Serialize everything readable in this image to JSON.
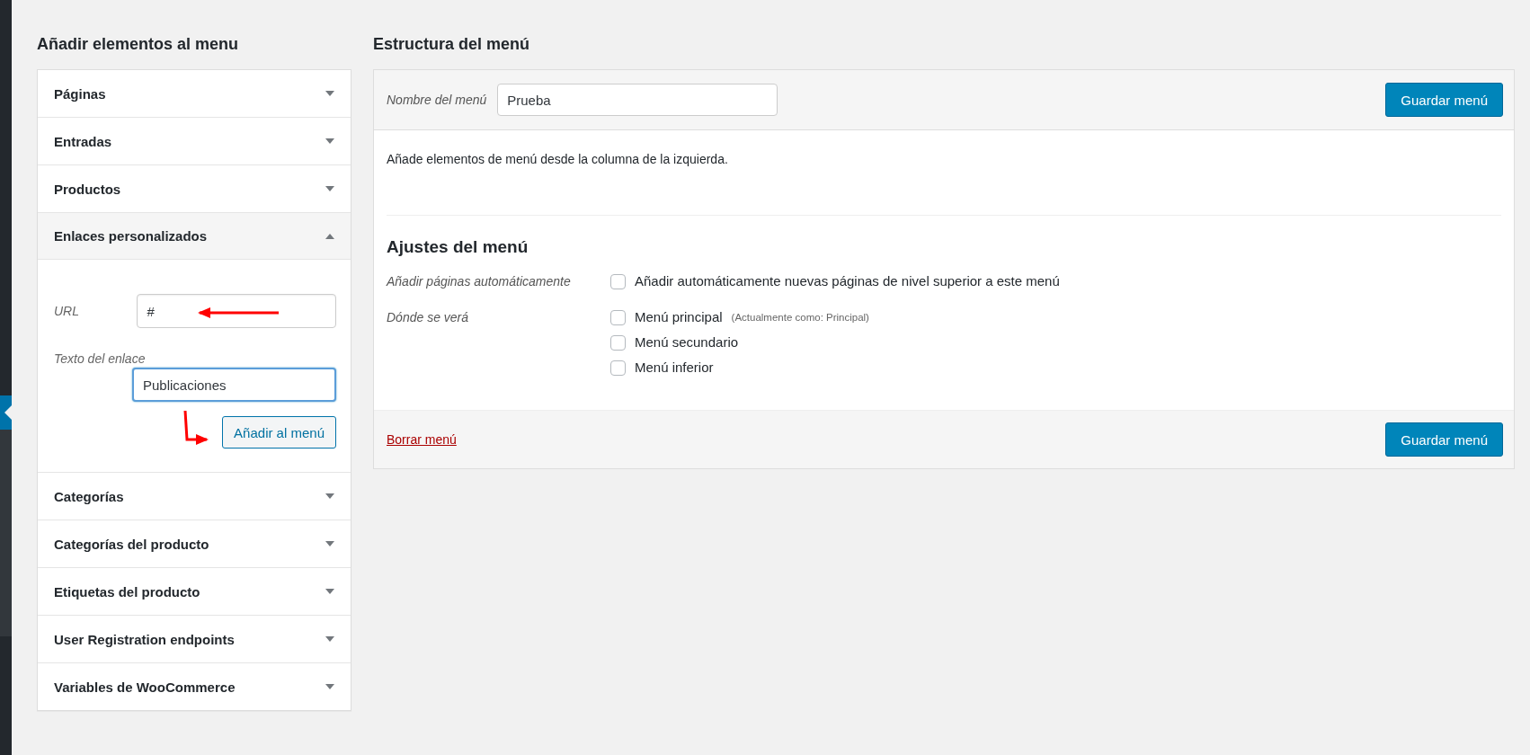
{
  "add_items": {
    "title": "Añadir elementos al menu",
    "sections": [
      {
        "label": "Páginas",
        "expanded": false
      },
      {
        "label": "Entradas",
        "expanded": false
      },
      {
        "label": "Productos",
        "expanded": false
      },
      {
        "label": "Enlaces personalizados",
        "expanded": true,
        "form": {
          "url": {
            "label": "URL",
            "value": "#",
            "focused": false
          },
          "link_text": {
            "label": "Texto del enlace",
            "value": "Publicaciones",
            "focused": true
          },
          "button": "Añadir al menú"
        }
      },
      {
        "label": "Categorías",
        "expanded": false
      },
      {
        "label": "Categorías del producto",
        "expanded": false
      },
      {
        "label": "Etiquetas del producto",
        "expanded": false
      },
      {
        "label": "User Registration endpoints",
        "expanded": false
      },
      {
        "label": "Variables de WooCommerce",
        "expanded": false
      }
    ]
  },
  "structure": {
    "title": "Estructura del menú",
    "menu_name_label": "Nombre del menú",
    "menu_name_value": "Prueba",
    "save_button": "Guardar menú",
    "instructions": "Añade elementos de menú desde la columna de la izquierda.",
    "settings": {
      "title": "Ajustes del menú",
      "groups": [
        {
          "label": "Añadir páginas automáticamente",
          "options": [
            {
              "label": "Añadir automáticamente nuevas páginas de nivel superior a este menú",
              "checked": false
            }
          ]
        },
        {
          "label": "Dónde se verá",
          "options": [
            {
              "label": "Menú principal",
              "note": "(Actualmente como: Principal)",
              "checked": false
            },
            {
              "label": "Menú secundario",
              "checked": false
            },
            {
              "label": "Menú inferior",
              "checked": false
            }
          ]
        }
      ]
    },
    "delete_link": "Borrar menú",
    "save_button_bottom": "Guardar menú"
  }
}
